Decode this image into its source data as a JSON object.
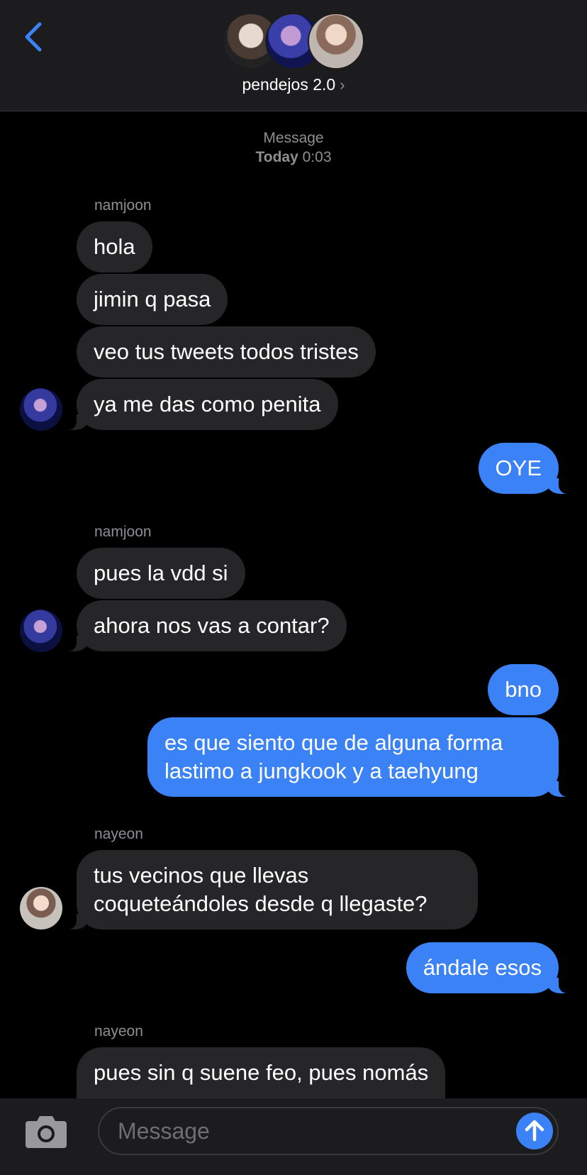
{
  "header": {
    "group_name": "pendejos 2.0",
    "chevron": "›"
  },
  "timestamp": {
    "label": "Message",
    "day": "Today",
    "time": "0:03"
  },
  "messages": [
    {
      "sender": "namjoon",
      "bubbles": [
        "hola",
        "jimin q pasa",
        "veo tus tweets todos tristes",
        "ya me das como penita"
      ]
    },
    {
      "sender": "me",
      "bubbles": [
        "OYE"
      ]
    },
    {
      "sender": "namjoon",
      "bubbles": [
        "pues la vdd si",
        "ahora nos vas a contar?"
      ]
    },
    {
      "sender": "me",
      "bubbles": [
        "bno",
        "es que siento que de alguna forma",
        "lastimo a jungkook y a taehyung"
      ]
    },
    {
      "sender": "nayeon",
      "bubbles": [
        "tus vecinos que llevas",
        "coqueteándoles desde q llegaste?"
      ]
    },
    {
      "sender": "me",
      "bubbles": [
        "ándale esos"
      ]
    },
    {
      "sender": "nayeon",
      "bubbles": [
        "pues sin q suene feo, pues nomás"
      ]
    }
  ],
  "composer": {
    "placeholder": "Message"
  },
  "icons": [
    "back-chevron-icon",
    "camera-icon",
    "send-arrow-icon",
    "chevron-right-icon"
  ],
  "colors": {
    "outgoing_bubble": "#3b82f6",
    "incoming_bubble": "#262628",
    "accent": "#3b82f6",
    "background": "#000000"
  }
}
